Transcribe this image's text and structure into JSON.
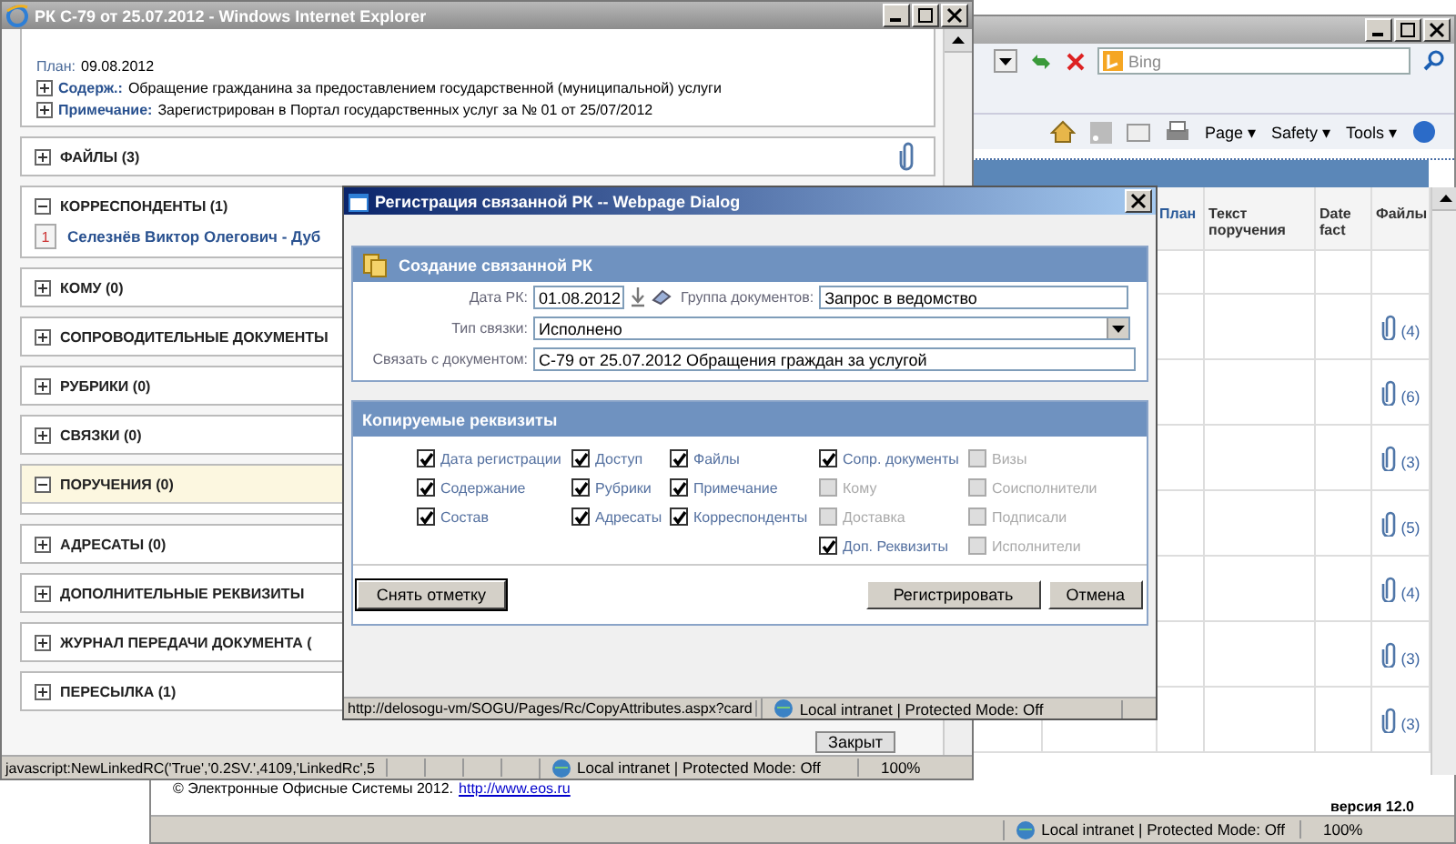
{
  "background_window": {
    "search_placeholder": "Bing",
    "command_bar": [
      "Page ▾",
      "Safety ▾",
      "Tools ▾"
    ],
    "table": {
      "columns": [
        "План",
        "Текст поручения",
        "Date fact",
        "Файлы"
      ],
      "rows": [
        {
          "has_files": false,
          "files": ""
        },
        {
          "has_files": true,
          "files": "(4)"
        },
        {
          "has_files": true,
          "files": "(6)"
        },
        {
          "has_files": true,
          "files": "(3)"
        },
        {
          "has_files": true,
          "files": "(5)"
        },
        {
          "has_files": true,
          "files": "(4)"
        },
        {
          "has_files": true,
          "files": "(3)"
        },
        {
          "has_files": true,
          "files": "(3)"
        }
      ]
    },
    "footer": {
      "copyright": "© Электронные Офисные Системы 2012.",
      "link": "http://www.eos.ru",
      "version": "версия 12.0"
    },
    "status_bar": {
      "zone": "Local intranet | Protected Mode: Off",
      "zoom": "100%"
    }
  },
  "main_window": {
    "title": "РК С-79 от 25.07.2012 - Windows Internet Explorer",
    "details": [
      {
        "label": "План:",
        "value": "09.08.2012",
        "expandable": false
      },
      {
        "label": "Содерж.:",
        "value": "Обращение гражданина за предоставлением государственной (муниципальной) услуги",
        "expandable": true
      },
      {
        "label": "Примечание:",
        "value": "Зарегистрирован в Портал государственных услуг за № 01 от 25/07/2012",
        "expandable": true
      }
    ],
    "sections": [
      {
        "title": "ФАЙЛЫ (3)",
        "expanded": false,
        "highlighted": false,
        "attachment": true
      },
      {
        "title": "КОРРЕСПОНДЕНТЫ (1)",
        "expanded": true,
        "highlighted": false,
        "items": [
          {
            "number": "1",
            "name": "Селезнёв Виктор Олегович - Дуб"
          }
        ]
      },
      {
        "title": "КОМУ (0)",
        "expanded": false,
        "highlighted": false
      },
      {
        "title": "СОПРОВОДИТЕЛЬНЫЕ ДОКУМЕНТЫ",
        "expanded": false,
        "highlighted": false
      },
      {
        "title": "РУБРИКИ (0)",
        "expanded": false,
        "highlighted": false
      },
      {
        "title": "СВЯЗКИ (0)",
        "expanded": false,
        "highlighted": false
      },
      {
        "title": "ПОРУЧЕНИЯ (0)",
        "expanded": true,
        "highlighted": true
      },
      {
        "title": "АДРЕСАТЫ (0)",
        "expanded": false,
        "highlighted": false
      },
      {
        "title": "ДОПОЛНИТЕЛЬНЫЕ РЕКВИЗИТЫ",
        "expanded": false,
        "highlighted": false
      },
      {
        "title": "ЖУРНАЛ ПЕРЕДАЧИ ДОКУМЕНТА (",
        "expanded": false,
        "highlighted": false
      },
      {
        "title": "ПЕРЕСЫЛКА (1)",
        "expanded": false,
        "highlighted": false
      }
    ],
    "close_button": "Закрыт",
    "status_bar": {
      "url": "javascript:NewLinkedRC('True','0.2SV.',4109,'LinkedRc',5",
      "zone": "Local intranet | Protected Mode: Off",
      "zoom": "100%"
    }
  },
  "dialog": {
    "title": "Регистрация связанной РК -- Webpage Dialog",
    "header": "Создание связанной РК",
    "date": {
      "label": "Дата РК:",
      "value": "01.08.2012"
    },
    "group": {
      "label": "Группа документов:",
      "value": "Запрос в ведомство"
    },
    "link_type": {
      "label": "Тип связки:",
      "value": "Исполнено"
    },
    "link_doc": {
      "label": "Связать с документом:",
      "value": "С-79 от 25.07.2012 Обращения граждан за услугой"
    },
    "copy_header": "Копируемые реквизиты",
    "columns": [
      [
        {
          "label": "Дата регистрации",
          "checked": true,
          "disabled": false
        },
        {
          "label": "Содержание",
          "checked": true,
          "disabled": false
        },
        {
          "label": "Состав",
          "checked": true,
          "disabled": false
        }
      ],
      [
        {
          "label": "Доступ",
          "checked": true,
          "disabled": false
        },
        {
          "label": "Рубрики",
          "checked": true,
          "disabled": false
        },
        {
          "label": "Адресаты",
          "checked": true,
          "disabled": false
        }
      ],
      [
        {
          "label": "Файлы",
          "checked": true,
          "disabled": false
        },
        {
          "label": "Примечание",
          "checked": true,
          "disabled": false
        },
        {
          "label": "Корреспонденты",
          "checked": true,
          "disabled": false
        }
      ],
      [
        {
          "label": "Сопр. документы",
          "checked": true,
          "disabled": false
        },
        {
          "label": "Кому",
          "checked": false,
          "disabled": true
        },
        {
          "label": "Доставка",
          "checked": false,
          "disabled": true
        },
        {
          "label": "Доп. Реквизиты",
          "checked": true,
          "disabled": false
        }
      ],
      [
        {
          "label": "Визы",
          "checked": false,
          "disabled": true
        },
        {
          "label": "Соисполнители",
          "checked": false,
          "disabled": true
        },
        {
          "label": "Подписали",
          "checked": false,
          "disabled": true
        },
        {
          "label": "Исполнители",
          "checked": false,
          "disabled": true
        }
      ]
    ],
    "buttons": {
      "uncheck": "Снять отметку",
      "register": "Регистрировать",
      "cancel": "Отмена"
    },
    "status_bar": {
      "url": "http://delosogu-vm/SOGU/Pages/Rc/CopyAttributes.aspx?card",
      "zone": "Local intranet | Protected Mode: Off"
    }
  }
}
